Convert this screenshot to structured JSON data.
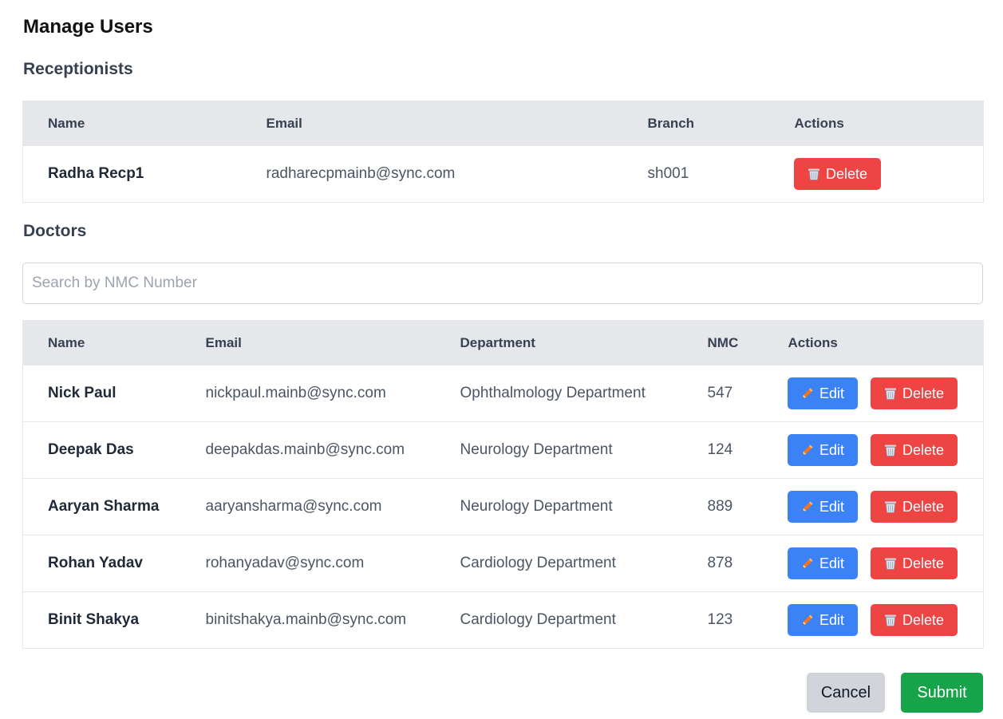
{
  "page": {
    "title": "Manage Users"
  },
  "receptionists": {
    "title": "Receptionists",
    "columns": [
      "Name",
      "Email",
      "Branch",
      "Actions"
    ],
    "rows": [
      {
        "name": "Radha Recp1",
        "email": "radharecpmainb@sync.com",
        "branch": "sh001",
        "delete_label": "Delete"
      }
    ]
  },
  "doctors": {
    "title": "Doctors",
    "search": {
      "placeholder": "Search by NMC Number",
      "value": ""
    },
    "columns": [
      "Name",
      "Email",
      "Department",
      "NMC",
      "Actions"
    ],
    "rows": [
      {
        "name": "Nick Paul",
        "email": "nickpaul.mainb@sync.com",
        "department": "Ophthalmology Department",
        "nmc": "547",
        "edit_label": "Edit",
        "delete_label": "Delete"
      },
      {
        "name": "Deepak Das",
        "email": "deepakdas.mainb@sync.com",
        "department": "Neurology Department",
        "nmc": "124",
        "edit_label": "Edit",
        "delete_label": "Delete"
      },
      {
        "name": "Aaryan Sharma",
        "email": "aaryansharma@sync.com",
        "department": "Neurology Department",
        "nmc": "889",
        "edit_label": "Edit",
        "delete_label": "Delete"
      },
      {
        "name": "Rohan Yadav",
        "email": "rohanyadav@sync.com",
        "department": "Cardiology Department",
        "nmc": "878",
        "edit_label": "Edit",
        "delete_label": "Delete"
      },
      {
        "name": "Binit Shakya",
        "email": "binitshakya.mainb@sync.com",
        "department": "Cardiology Department",
        "nmc": "123",
        "edit_label": "Edit",
        "delete_label": "Delete"
      }
    ]
  },
  "footer": {
    "cancel_label": "Cancel",
    "submit_label": "Submit"
  },
  "icons": {
    "edit": "pencil-icon",
    "delete": "wastebasket-icon"
  },
  "colors": {
    "delete": "#ef4444",
    "edit": "#3b82f6",
    "submit": "#16a34a",
    "cancel": "#d1d5db",
    "header_bg": "#e5e7eb"
  }
}
